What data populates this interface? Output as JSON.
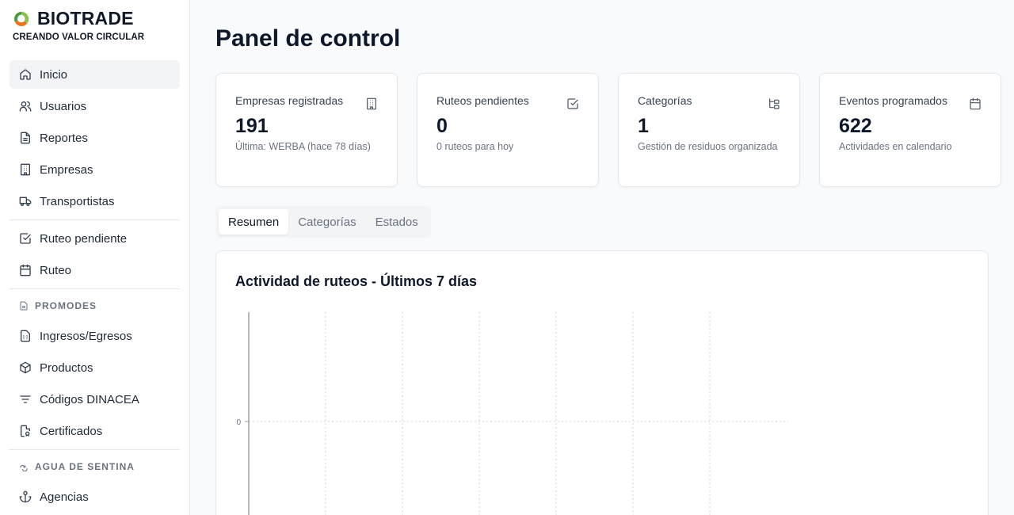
{
  "brand": {
    "name": "BIOTRADE",
    "tagline": "CREANDO VALOR CIRCULAR",
    "colors": {
      "green": "#4a9b3f",
      "orange": "#e8761e"
    }
  },
  "sidebar": {
    "items": [
      {
        "key": "inicio",
        "label": "Inicio",
        "icon": "home-icon",
        "active": true
      },
      {
        "key": "usuarios",
        "label": "Usuarios",
        "icon": "users-icon"
      },
      {
        "key": "reportes",
        "label": "Reportes",
        "icon": "file-icon"
      },
      {
        "key": "empresas",
        "label": "Empresas",
        "icon": "building-icon"
      },
      {
        "key": "transportistas",
        "label": "Transportistas",
        "icon": "truck-icon"
      },
      {
        "key": "ruteo-pendiente",
        "label": "Ruteo pendiente",
        "icon": "check-square-icon"
      },
      {
        "key": "ruteo",
        "label": "Ruteo",
        "icon": "calendar-icon"
      },
      {
        "key": "ingresos-egresos",
        "label": "Ingresos/Egresos",
        "icon": "spreadsheet-icon"
      },
      {
        "key": "productos",
        "label": "Productos",
        "icon": "box-icon"
      },
      {
        "key": "codigos-dinacea",
        "label": "Códigos DINACEA",
        "icon": "filter-icon"
      },
      {
        "key": "certificados",
        "label": "Certificados",
        "icon": "certificate-icon"
      },
      {
        "key": "agencias",
        "label": "Agencias",
        "icon": "anchor-icon"
      }
    ],
    "groups": [
      {
        "key": "promodes",
        "label": "PROMODES",
        "icon": "file-small-icon"
      },
      {
        "key": "agua-de-sentina",
        "label": "AGUA DE SENTINA",
        "icon": "waves-icon"
      }
    ]
  },
  "main": {
    "title": "Panel de control",
    "cards": [
      {
        "key": "empresas",
        "title": "Empresas registradas",
        "value": "191",
        "sub": "Última: WERBA (hace 78 días)",
        "icon": "building-icon"
      },
      {
        "key": "ruteos",
        "title": "Ruteos pendientes",
        "value": "0",
        "sub": "0 ruteos para hoy",
        "icon": "check-square-icon"
      },
      {
        "key": "categorias",
        "title": "Categorías",
        "value": "1",
        "sub": "Gestión de residuos organizada",
        "icon": "folder-tree-icon"
      },
      {
        "key": "eventos",
        "title": "Eventos programados",
        "value": "622",
        "sub": "Actividades en calendario",
        "icon": "calendar-icon"
      }
    ],
    "tabs": [
      {
        "key": "resumen",
        "label": "Resumen",
        "active": true
      },
      {
        "key": "categorias",
        "label": "Categorías"
      },
      {
        "key": "estados",
        "label": "Estados"
      }
    ],
    "chart": {
      "title": "Actividad de ruteos - Últimos 7 días"
    }
  },
  "chart_data": {
    "type": "bar",
    "title": "Actividad de ruteos - Últimos 7 días",
    "categories": [],
    "values": [],
    "y_ticks": [
      "0"
    ],
    "grid": true,
    "xlabel": "",
    "ylabel": ""
  }
}
